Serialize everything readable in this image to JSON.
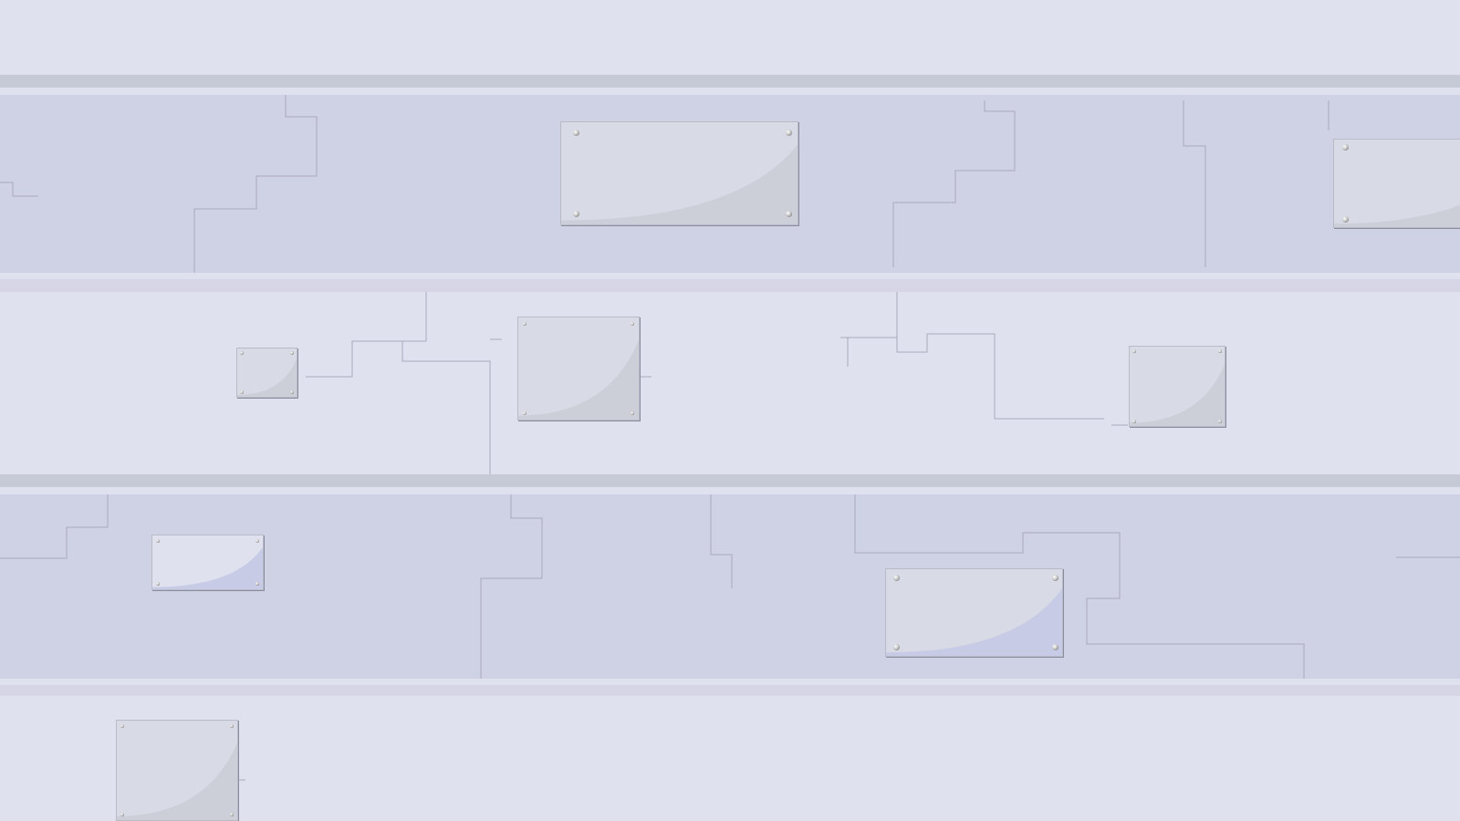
{
  "colors": {
    "background": "#dfe2ee",
    "band_dark": "#cfd2e5",
    "band_light": "#dfe2ee",
    "divider": "#c6c9d6",
    "divider_light": "#d5d5e6",
    "wire": "#a8a8bc",
    "plate": "#d8dbe5",
    "plate_shadow_area": "#cccfd8",
    "plate_blue_area": "#c8cbe5"
  },
  "panel_rows": 4,
  "plates": [
    {
      "id": "plate-1",
      "row": 1,
      "tint": "gray"
    },
    {
      "id": "plate-2",
      "row": 1,
      "tint": "gray"
    },
    {
      "id": "plate-3",
      "row": 2,
      "tint": "gray"
    },
    {
      "id": "plate-4",
      "row": 2,
      "tint": "gray"
    },
    {
      "id": "plate-5",
      "row": 2,
      "tint": "gray"
    },
    {
      "id": "plate-6",
      "row": 3,
      "tint": "blue"
    },
    {
      "id": "plate-7",
      "row": 3,
      "tint": "blue"
    },
    {
      "id": "plate-8",
      "row": 4,
      "tint": "gray"
    }
  ]
}
